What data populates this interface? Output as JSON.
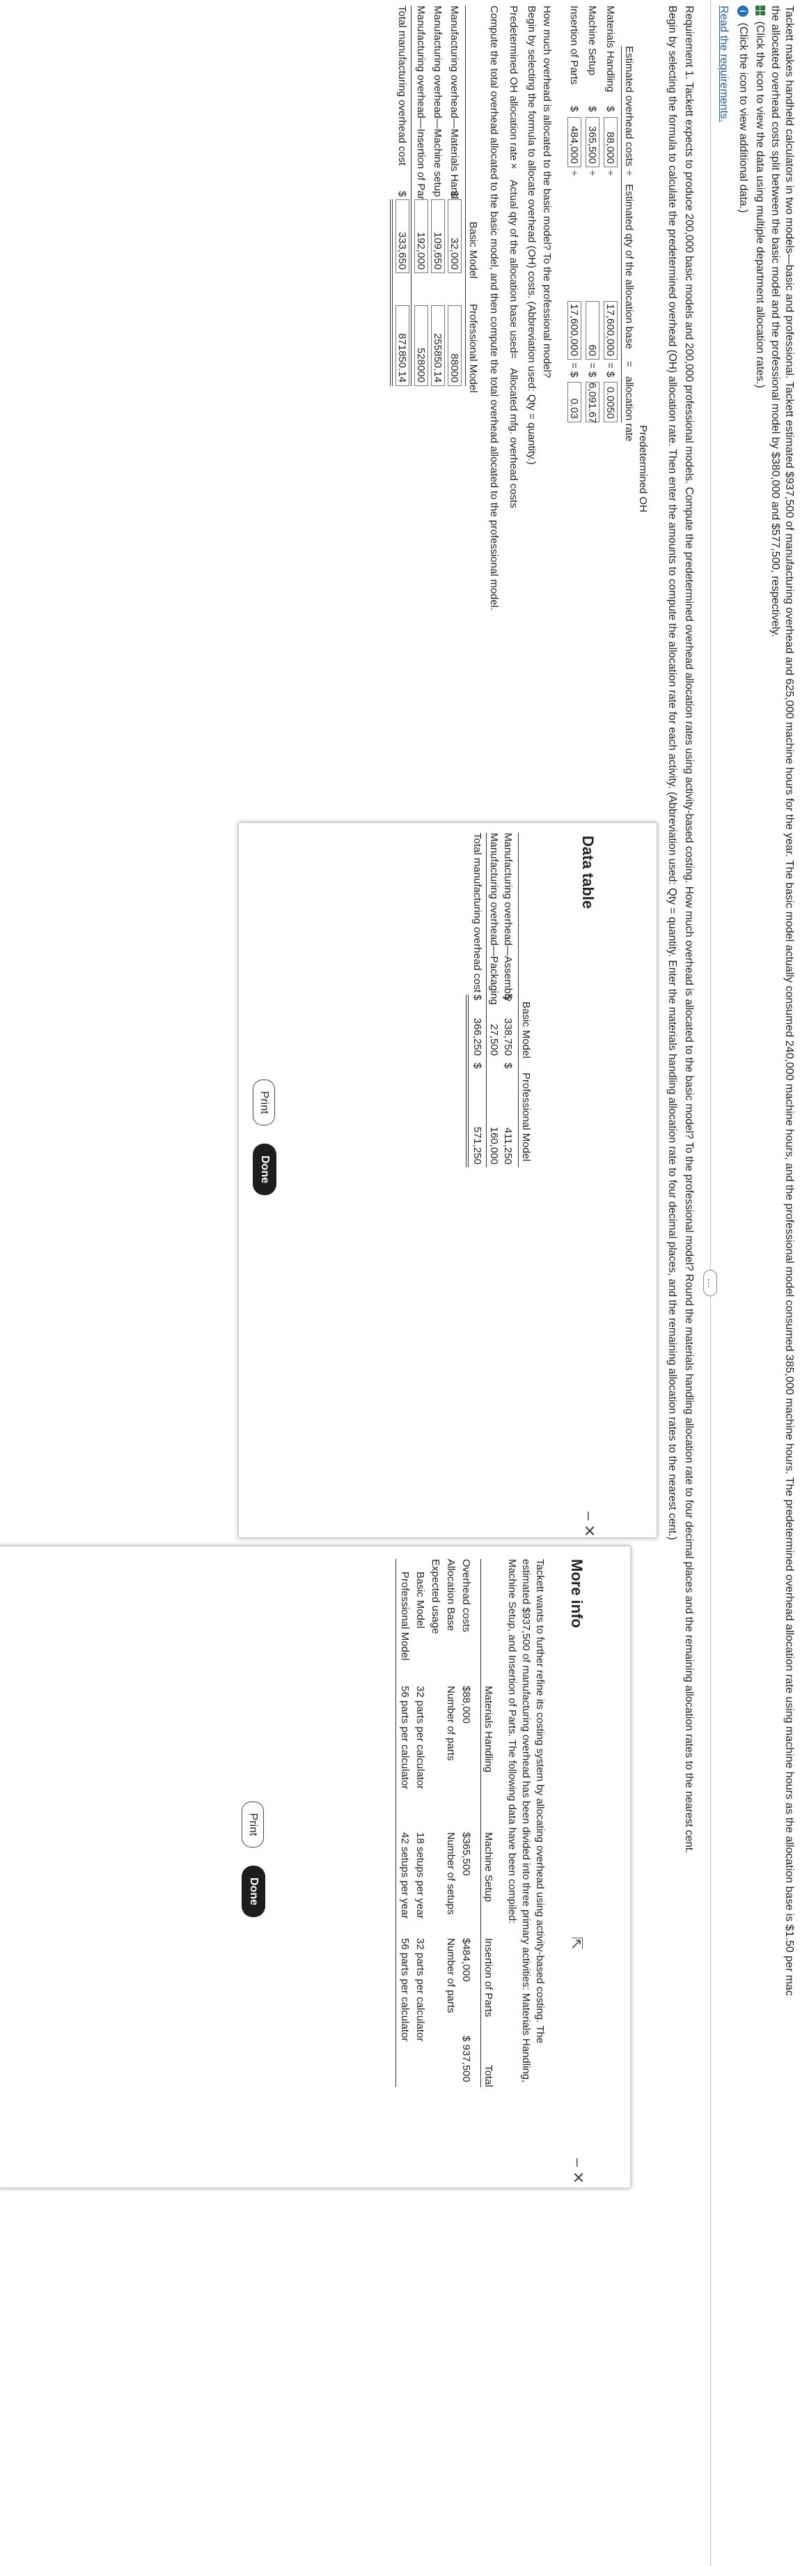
{
  "problem": {
    "line1": "Tackett makes handheld calculators in two models—basic and professional. Tackett estimated $937,500 of manufacturing overhead and 625,000 machine hours for the year. The basic model actually consumed 240,000 machine hours, and the professional model consumed 385,000 machine hours. The predetermined overhead allocation rate using machine hours as the allocation base is $1.50 per mac",
    "line2": "the allocated overhead costs split between the basic model and the professional model by $380,000 and $577,500, respectively.",
    "data_link": "(Click the icon to view the data using multiple department allocation rates.)",
    "info_link": "(Click the icon to view additional data.)",
    "requirements_link": "Read the requirements.",
    "ellipsis": "…"
  },
  "requirement": {
    "text": "Requirement 1. Tackett expects to produce 200,000 basic models and 200,000 professional models. Compute the predetermined overhead allocation rates using activity-based costing. How much overhead is allocated to the basic model? To the professional model? Round the materials handling allocation rate to four decimal places and the remaining allocation rates to the nearest cent.",
    "begin": "Begin by selecting the formula to calculate the predetermined overhead (OH) allocation rate. Then enter the amounts to compute the allocation rate for each activity. (Abbreviation used: Qty = quantity. Enter the materials handling allocation rate to four decimal places, and the remaining allocation rates to the nearest cent.)"
  },
  "rate_table": {
    "col1": "Estimated overhead costs",
    "op1": "÷",
    "col2": "Estimated qty of the allocation base",
    "op2": "=",
    "col3_line1": "Predetermined OH",
    "col3_line2": "allocation rate",
    "rows": [
      {
        "label": "Materials Handling",
        "dollar": "$",
        "cost": "88,000",
        "op": "÷",
        "qty": "17,600,000",
        "eq": "= $",
        "rate": "0.0050"
      },
      {
        "label": "Machine Setup",
        "dollar": "$",
        "cost": "365,500",
        "op": "÷",
        "qty": "60",
        "eq": "= $",
        "rate": "6,091.67"
      },
      {
        "label": "Insertion of Parts",
        "dollar": "$",
        "cost": "484,000",
        "op": "÷",
        "qty": "17,600,000",
        "eq": "= $",
        "rate": "0.03"
      }
    ]
  },
  "alloc": {
    "question": "How much overhead is allocated to the basic model? To the professional model?",
    "begin": "Begin by selecting the formula to allocate overhead (OH) costs. (Abbreviation used: Qty = quantity.)",
    "f1": "Predetermined OH allocation rate",
    "f2": "×",
    "f3": "Actual qty of the allocation base used",
    "f4": "=",
    "f5": "Allocated mfg. overhead costs",
    "compute": "Compute the total overhead allocated to the basic model, and then compute the total overhead allocated to the professional model.",
    "head_basic": "Basic Model",
    "head_pro": "Professional Model",
    "rows": [
      {
        "label": "Manufacturing overhead—Materials Handling",
        "dollar": "$",
        "basic": "32,000",
        "pro": "88000"
      },
      {
        "label": "Manufacturing overhead—Machine setup",
        "dollar": "",
        "basic": "109,650",
        "pro": "255850.14"
      },
      {
        "label": "Manufacturing overhead—Insertion of Parts",
        "dollar": "",
        "basic": "192,000",
        "pro": "528000"
      }
    ],
    "total_label": "Total manufacturing overhead cost",
    "total_dollar": "$",
    "total_basic": "333,650",
    "total_pro": "871850.14"
  },
  "data_table": {
    "title": "Data table",
    "head_basic": "Basic Model",
    "head_pro": "Professional Model",
    "rows": [
      {
        "label": "Manufacturing overhead—Assembly",
        "d1": "$",
        "basic": "338,750",
        "d2": "$",
        "pro": "411,250"
      },
      {
        "label": "Manufacturing overhead—Packaging",
        "d1": "",
        "basic": "27,500",
        "d2": "",
        "pro": "160,000"
      }
    ],
    "total_label": "Total manufacturing overhead cost",
    "total_d1": "$",
    "total_basic": "366,250",
    "total_d2": "$",
    "total_pro": "571,250",
    "print": "Print",
    "done": "Done"
  },
  "more_info": {
    "title": "More info",
    "para": [
      "Tackett wants to further refine its costing system by allocating overhead using activity-based costing. The",
      "estimated $937,500 of manufacturing overhead has been divided into three primary activities: Materials Handling,",
      "Machine Setup, and Insertion of Parts. The following data have been compiled:"
    ],
    "headers": [
      "Materials Handling",
      "Machine Setup",
      "Insertion of Parts",
      "Total"
    ],
    "overhead_label": "Overhead costs",
    "overhead": [
      "$88,000",
      "$365,500",
      "$484,000",
      "$ 937,500"
    ],
    "base_label": "Allocation Base",
    "base": [
      "Number of parts",
      "Number of setups",
      "Number of parts"
    ],
    "usage_label": "Expected usage",
    "basic_label": "Basic Model",
    "basic": [
      "32 parts per calculator",
      "18 setups per year",
      "32 parts per calculator"
    ],
    "pro_label": "Professional Model",
    "pro": [
      "56 parts per calculator",
      "42 setups per year",
      "56 parts per calculator"
    ],
    "print": "Print",
    "done": "Done"
  }
}
